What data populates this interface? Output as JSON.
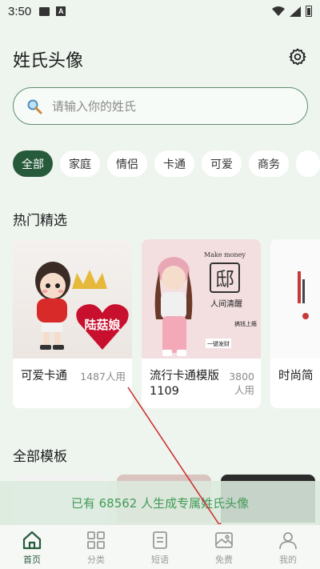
{
  "status_bar": {
    "time": "3:50"
  },
  "header": {
    "title": "姓氏头像"
  },
  "search": {
    "placeholder": "请输入你的姓氏"
  },
  "categories": {
    "items": [
      "全部",
      "家庭",
      "情侣",
      "卡通",
      "可爱",
      "商务"
    ],
    "selected": "全部"
  },
  "hot": {
    "title": "热门精选",
    "cards": [
      {
        "name": "可爱卡通",
        "count": "1487人用",
        "image_text": "陆菇娘"
      },
      {
        "name": "流行卡通模版1109",
        "count": "3800人用",
        "image_text": [
          "Make money",
          "邸",
          "人间清醒",
          "一键发财",
          "搞钱上瘾"
        ]
      },
      {
        "name": "时尚简",
        "count": ""
      }
    ]
  },
  "all_templates": {
    "title": "全部模板"
  },
  "banner": {
    "text": "已有 68562 人生成专属姓氏头像"
  },
  "nav": {
    "items": [
      {
        "label": "首页",
        "icon": "home-icon",
        "active": true
      },
      {
        "label": "分类",
        "icon": "grid-icon",
        "active": false
      },
      {
        "label": "短语",
        "icon": "document-icon",
        "active": false
      },
      {
        "label": "免费",
        "icon": "image-icon",
        "active": false
      },
      {
        "label": "我的",
        "icon": "user-icon",
        "active": false
      }
    ]
  },
  "colors": {
    "accent": "#275a3b",
    "banner_text": "#3f9b57",
    "background": "#eef5ef",
    "annotation_arrow": "#d0262a"
  }
}
